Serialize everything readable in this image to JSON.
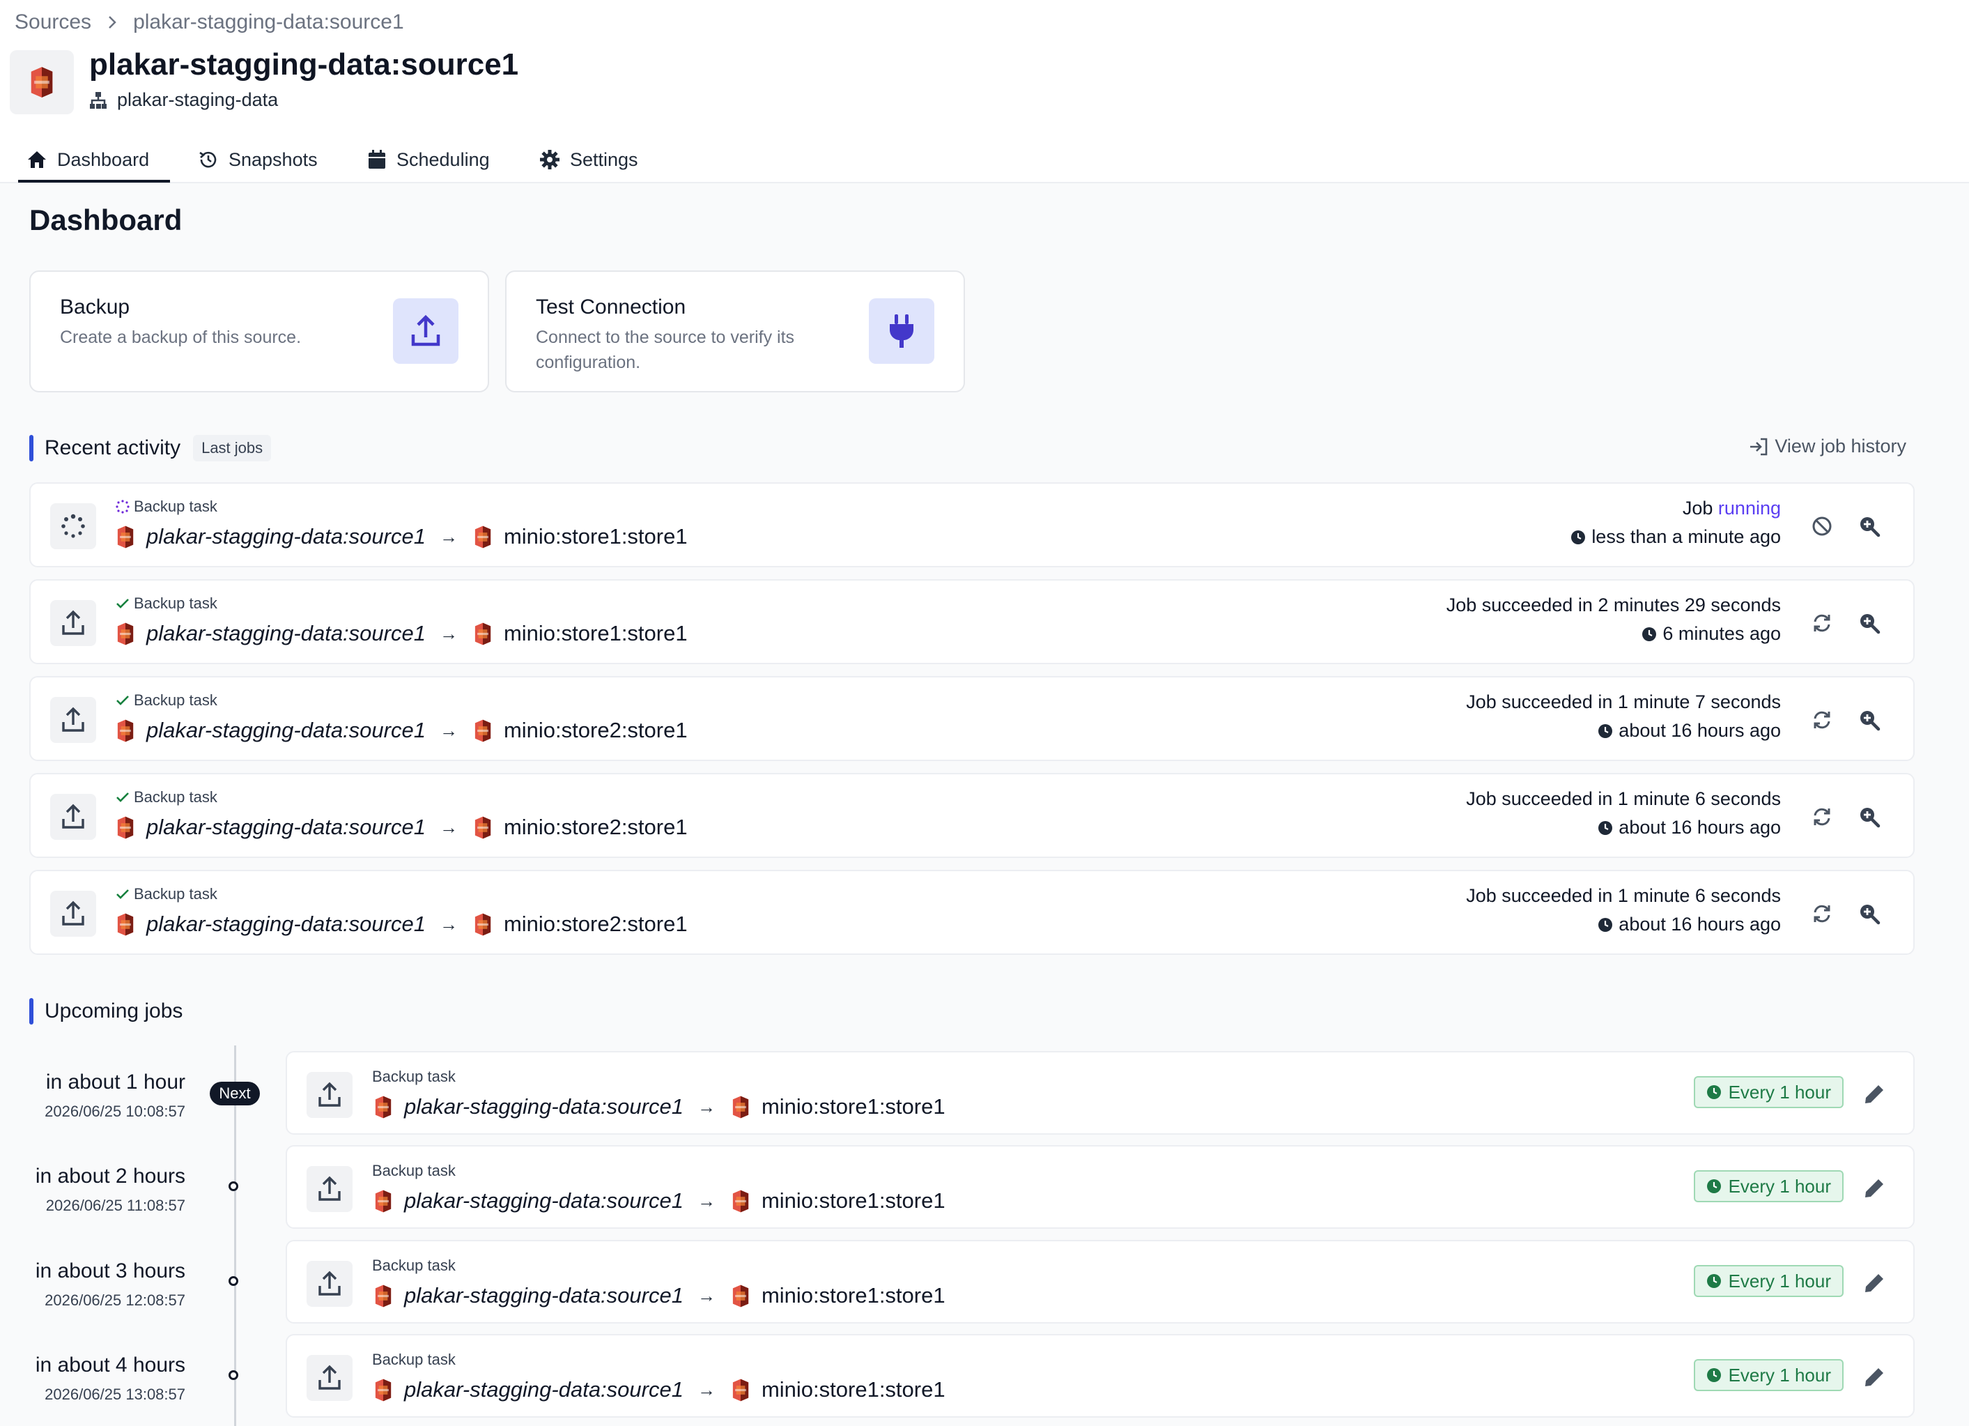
{
  "breadcrumb": {
    "root": "Sources",
    "current": "plakar-stagging-data:source1"
  },
  "header": {
    "title": "plakar-stagging-data:source1",
    "subtitle": "plakar-staging-data"
  },
  "tabs": [
    {
      "label": "Dashboard",
      "icon": "home-icon",
      "active": true
    },
    {
      "label": "Snapshots",
      "icon": "history-icon",
      "active": false
    },
    {
      "label": "Scheduling",
      "icon": "calendar-icon",
      "active": false
    },
    {
      "label": "Settings",
      "icon": "gear-icon",
      "active": false
    }
  ],
  "page_title": "Dashboard",
  "actions": {
    "backup": {
      "title": "Backup",
      "description": "Create a backup of this source.",
      "icon": "upload-icon"
    },
    "test_connection": {
      "title": "Test Connection",
      "description": "Connect to the source to verify its configuration.",
      "icon": "plug-icon"
    }
  },
  "recent": {
    "title": "Recent activity",
    "badge": "Last jobs",
    "view_history": "View job history",
    "jobs": [
      {
        "task": "Backup task",
        "state_icon": "spinner-icon",
        "source": "plakar-stagging-data:source1",
        "arrow": "→",
        "dest": "minio:store1:store1",
        "status_prefix": "Job ",
        "status_value": "running",
        "time": "less than a minute ago",
        "action": "cancel-icon"
      },
      {
        "task": "Backup task",
        "state_icon": "check-icon",
        "source": "plakar-stagging-data:source1",
        "arrow": "→",
        "dest": "minio:store1:store1",
        "status_prefix": "Job succeeded in 2 minutes 29 seconds",
        "status_value": "",
        "time": "6 minutes ago",
        "action": "retry-icon"
      },
      {
        "task": "Backup task",
        "state_icon": "check-icon",
        "source": "plakar-stagging-data:source1",
        "arrow": "→",
        "dest": "minio:store2:store1",
        "status_prefix": "Job succeeded in 1 minute 7 seconds",
        "status_value": "",
        "time": "about 16 hours ago",
        "action": "retry-icon"
      },
      {
        "task": "Backup task",
        "state_icon": "check-icon",
        "source": "plakar-stagging-data:source1",
        "arrow": "→",
        "dest": "minio:store2:store1",
        "status_prefix": "Job succeeded in 1 minute 6 seconds",
        "status_value": "",
        "time": "about 16 hours ago",
        "action": "retry-icon"
      },
      {
        "task": "Backup task",
        "state_icon": "check-icon",
        "source": "plakar-stagging-data:source1",
        "arrow": "→",
        "dest": "minio:store2:store1",
        "status_prefix": "Job succeeded in 1 minute 6 seconds",
        "status_value": "",
        "time": "about 16 hours ago",
        "action": "retry-icon"
      }
    ]
  },
  "upcoming": {
    "title": "Upcoming jobs",
    "next_badge": "Next",
    "jobs": [
      {
        "when": "in about 1 hour",
        "date": "2026/06/25 10:08:57",
        "task": "Backup task",
        "source": "plakar-stagging-data:source1",
        "arrow": "→",
        "dest": "minio:store1:store1",
        "frequency": "Every 1 hour"
      },
      {
        "when": "in about 2 hours",
        "date": "2026/06/25 11:08:57",
        "task": "Backup task",
        "source": "plakar-stagging-data:source1",
        "arrow": "→",
        "dest": "minio:store1:store1",
        "frequency": "Every 1 hour"
      },
      {
        "when": "in about 3 hours",
        "date": "2026/06/25 12:08:57",
        "task": "Backup task",
        "source": "plakar-stagging-data:source1",
        "arrow": "→",
        "dest": "minio:store1:store1",
        "frequency": "Every 1 hour"
      },
      {
        "when": "in about 4 hours",
        "date": "2026/06/25 13:08:57",
        "task": "Backup task",
        "source": "plakar-stagging-data:source1",
        "arrow": "→",
        "dest": "minio:store1:store1",
        "frequency": "Every 1 hour"
      }
    ]
  },
  "colors": {
    "accent": "#2f4fd8",
    "running": "#5b3ff2",
    "success_bg": "#e6f6ec",
    "success_text": "#1e7a46",
    "s3_red": "#c0392b"
  }
}
